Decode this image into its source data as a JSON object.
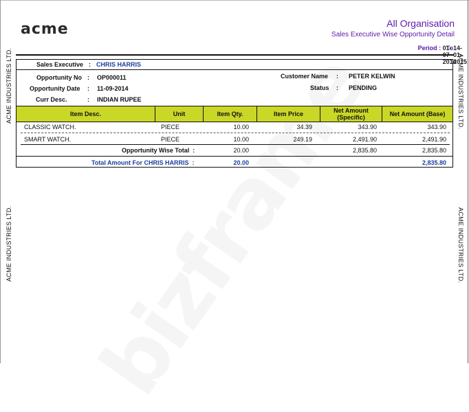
{
  "company": {
    "logo_text": "acme",
    "org_name": "All Organisation",
    "side_label": "ACME INDUSTRIES LTD."
  },
  "report": {
    "title": "Sales Executive Wise Opportunity Detail",
    "period_label": "Period :",
    "period_from": "01-07-2014",
    "to_label": "To",
    "period_to": "14-01-2015"
  },
  "executive": {
    "label": "Sales Executive",
    "name": "CHRIS HARRIS"
  },
  "opportunity": {
    "no_label": "Opportunity No",
    "no": "OP000011",
    "date_label": "Opportunity Date",
    "date": "11-09-2014",
    "curr_label": "Curr  Desc.",
    "curr": "INDIAN RUPEE",
    "customer_label": "Customer Name",
    "customer": "PETER KELWIN",
    "status_label": "Status",
    "status": "PENDING"
  },
  "table": {
    "headers": [
      "Item Desc.",
      "Unit",
      "Item Qty.",
      "Item Price",
      "Net Amount (Specific)",
      "Net Amount (Base)"
    ],
    "rows": [
      [
        "CLASSIC WATCH.",
        "PIECE",
        "10.00",
        "34.39",
        "343.90",
        "343.90"
      ],
      [
        "SMART WATCH.",
        "PIECE",
        "10.00",
        "249.19",
        "2,491.90",
        "2,491.90"
      ]
    ],
    "opp_total_label": "Opportunity Wise Total",
    "opp_total_qty": "20.00",
    "opp_total_specific": "2,835.80",
    "opp_total_base": "2,835.80",
    "exec_total_label": "Total Amount For CHRIS HARRIS",
    "exec_total_qty": "20.00",
    "exec_total_base": "2,835.80"
  },
  "watermark": "bizframe"
}
